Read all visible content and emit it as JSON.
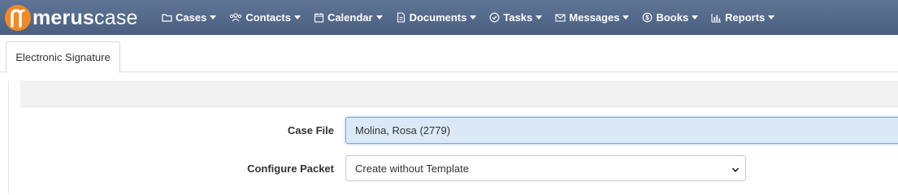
{
  "brand": {
    "part1": "merus",
    "part2": "case",
    "accent": "#f08a24",
    "navbar_color": "#52688a"
  },
  "nav": [
    {
      "label": "Cases",
      "icon": "folder-icon"
    },
    {
      "label": "Contacts",
      "icon": "users-icon"
    },
    {
      "label": "Calendar",
      "icon": "calendar-icon"
    },
    {
      "label": "Documents",
      "icon": "document-icon"
    },
    {
      "label": "Tasks",
      "icon": "check-circle-icon"
    },
    {
      "label": "Messages",
      "icon": "envelope-icon"
    },
    {
      "label": "Books",
      "icon": "dollar-circle-icon"
    },
    {
      "label": "Reports",
      "icon": "bar-chart-icon"
    }
  ],
  "tabs": [
    {
      "label": "Electronic Signature"
    }
  ],
  "form": {
    "case_file_label": "Case File",
    "case_file_value": "Molina, Rosa (2779)",
    "configure_packet_label": "Configure Packet",
    "configure_packet_value": "Create without Template"
  }
}
